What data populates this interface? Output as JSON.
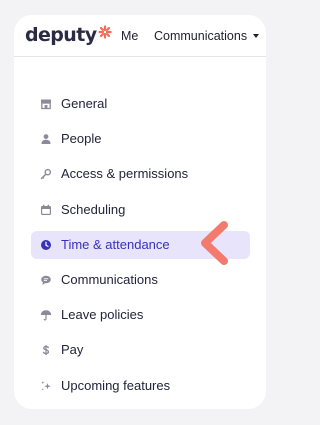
{
  "header": {
    "logo_text": "deputy",
    "nav_me": "Me",
    "nav_communications": "Communications"
  },
  "colors": {
    "active_bg": "#e7e4fb",
    "active_text": "#3a31b8",
    "logo_mark": "#f26b5b",
    "pointer": "#f47a6d"
  },
  "menu": {
    "items": [
      {
        "label": "General",
        "icon": "store-icon",
        "active": false
      },
      {
        "label": "People",
        "icon": "person-icon",
        "active": false
      },
      {
        "label": "Access & permissions",
        "icon": "key-icon",
        "active": false
      },
      {
        "label": "Scheduling",
        "icon": "calendar-icon",
        "active": false
      },
      {
        "label": "Time & attendance",
        "icon": "clock-icon",
        "active": true
      },
      {
        "label": "Communications",
        "icon": "chat-icon",
        "active": false
      },
      {
        "label": "Leave policies",
        "icon": "umbrella-icon",
        "active": false
      },
      {
        "label": "Pay",
        "icon": "dollar-icon",
        "active": false
      },
      {
        "label": "Upcoming features",
        "icon": "sparkle-icon",
        "active": false
      }
    ]
  }
}
